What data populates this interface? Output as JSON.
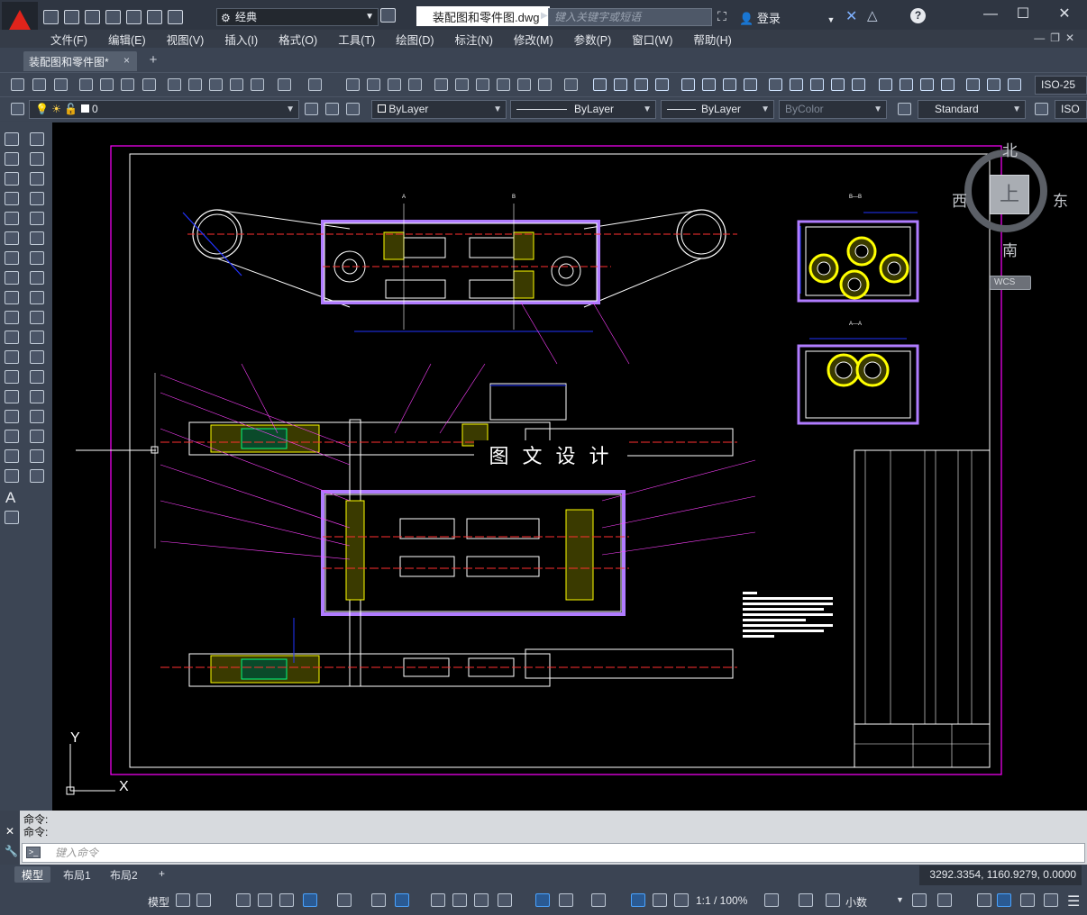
{
  "window": {
    "title": "装配图和零件图.dwg",
    "workspace": "经典",
    "search_placeholder": "键入关键字或短语",
    "login": "登录"
  },
  "menu": [
    "文件(F)",
    "编辑(E)",
    "视图(V)",
    "插入(I)",
    "格式(O)",
    "工具(T)",
    "绘图(D)",
    "标注(N)",
    "修改(M)",
    "参数(P)",
    "窗口(W)",
    "帮助(H)"
  ],
  "file_tab": {
    "label": "装配图和零件图*",
    "close": "×"
  },
  "toolbar": {
    "dimstyle": "ISO-25",
    "layer": "0",
    "color": "ByLayer",
    "linetype": "ByLayer",
    "lineweight": "ByLayer",
    "plotstyle": "ByColor",
    "textstyle": "Standard",
    "dimstyle2": "ISO"
  },
  "viewcube": {
    "north": "北",
    "south": "南",
    "east": "东",
    "west": "西",
    "top": "上",
    "wcs": "WCS"
  },
  "drawing": {
    "watermark": "图 文 设 计",
    "section_bb": "B—B",
    "section_aa": "A—A",
    "cut_a": "A",
    "cut_b": "B"
  },
  "ucs": {
    "x": "X",
    "y": "Y"
  },
  "command": {
    "history": [
      "命令:",
      "命令:"
    ],
    "placeholder": "键入命令"
  },
  "layout_tabs": [
    "模型",
    "布局1",
    "布局2"
  ],
  "coordinates": "3292.3354, 1160.9279, 0.0000",
  "status": {
    "model": "模型",
    "scale": "1:1 / 100%",
    "units": "小数"
  }
}
